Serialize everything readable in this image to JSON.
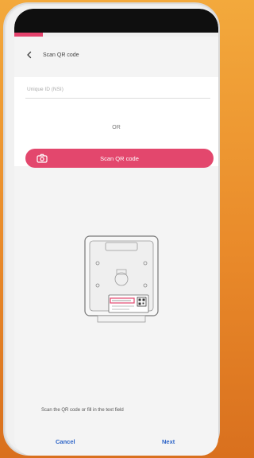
{
  "header": {
    "title": "Scan QR code"
  },
  "progress": {
    "fraction": 0.14,
    "color": "#e4426c"
  },
  "form": {
    "placeholder": "Unique ID (NSI)"
  },
  "divider": {
    "or_text": "OR"
  },
  "scan": {
    "label": "Scan QR code",
    "icon": "camera-icon",
    "color": "#e3476d"
  },
  "hint": {
    "text": "Scan the QR code or fill in the text field"
  },
  "footer": {
    "cancel_label": "Cancel",
    "next_label": "Next",
    "color": "#2b63c7"
  }
}
